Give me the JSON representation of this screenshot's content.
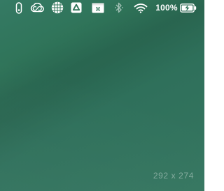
{
  "menubar": {
    "icons": [
      "usb-drive-icon",
      "creative-cloud-icon",
      "globe-grid-icon",
      "google-drive-icon",
      "command-key-icon",
      "bluetooth-icon",
      "wifi-icon",
      "battery-charging-icon"
    ],
    "battery_percent": "100%"
  },
  "desktop": {
    "size_label": "292 x 274"
  },
  "colors": {
    "wallpaper": "#2f7459",
    "menubar_text": "#ffffff"
  }
}
